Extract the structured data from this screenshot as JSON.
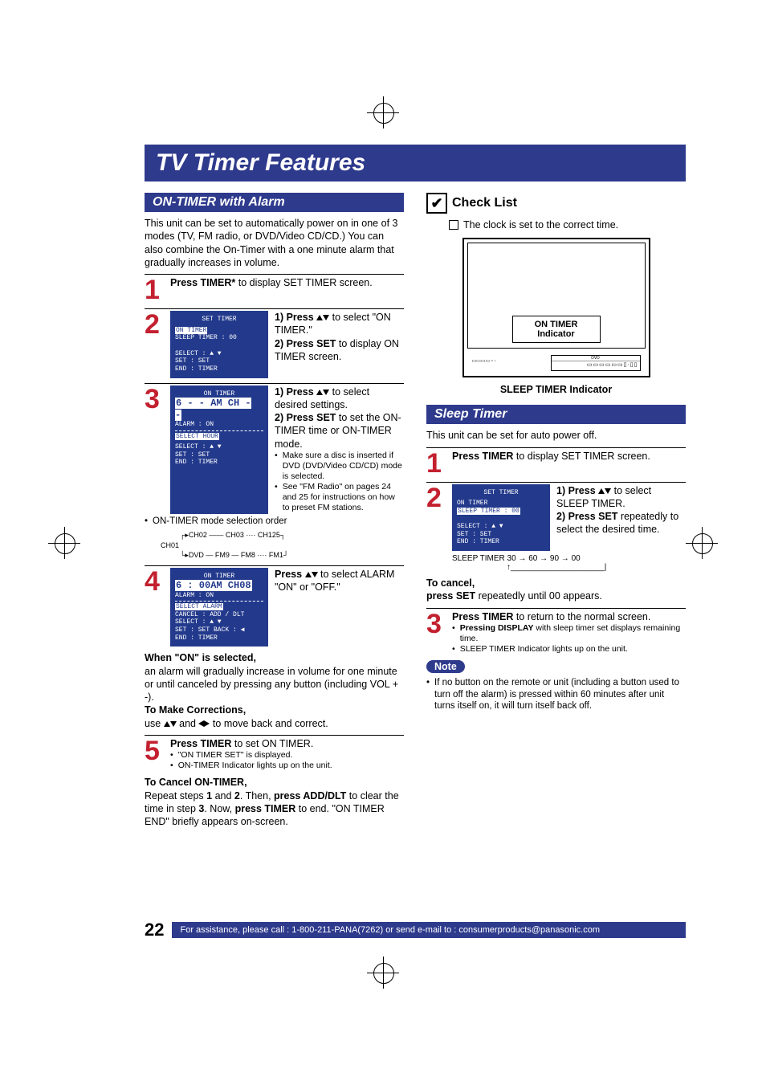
{
  "title": "TV Timer Features",
  "sections": {
    "on_timer_alarm": {
      "header": "ON-TIMER with Alarm",
      "intro": "This unit can be set to automatically power on in one of 3 modes (TV, FM radio, or DVD/Video CD/CD.) You can also combine the On-Timer with a one minute alarm that gradually increases in volume.",
      "step1": {
        "pre": "Press TIMER*",
        "post": " to display SET TIMER screen."
      },
      "step2": {
        "screen": {
          "title": "SET   TIMER",
          "line1_hl": "ON   TIMER",
          "line2": "SLEEP   TIMER : 00",
          "select": "SELECT : ▲  ▼",
          "set": "SET        : SET",
          "end": "END       : TIMER"
        },
        "r1a": "1)  Press ",
        "r1b": " to select \"ON TIMER.\"",
        "r2a": "2)  Press SET",
        "r2b": " to display ON TIMER screen."
      },
      "step3": {
        "screen": {
          "title": "ON   TIMER",
          "time_hl": "6 - - AM  CH - -",
          "alarm": "ALARM : ON",
          "select_line_hl": "SELECT  HOUR",
          "select": "SELECT : ▲  ▼",
          "set": "SET        : SET",
          "end": "END       : TIMER"
        },
        "r1a": "1)  Press ",
        "r1b": " to select desired settings.",
        "r2a": "2)  Press SET",
        "r2b": " to set the ON-TIMER time or ON-TIMER mode.",
        "b1": "Make sure a disc is inserted if DVD (DVD/Video CD/CD) mode is selected.",
        "b2": "See \"FM Radio\" on pages 24 and 25 for instructions on how to preset FM stations.",
        "mode_label": "ON-TIMER mode selection order",
        "chain1": "CH02 —— CH03 ···· CH125",
        "chain_left": "CH01",
        "chain2": "DVD — FM9 — FM8 ···· FM1"
      },
      "step4": {
        "screen": {
          "title": "ON   TIMER",
          "time_hl": "6 : 00AM  CH08",
          "alarm": "ALARM : ON",
          "select_line_hl": "SELECT  ALARM",
          "cancel": "CANCEL : ADD / DLT",
          "select": "SELECT : ▲  ▼",
          "set": "SET        : SET             BACK : ◀",
          "end": "END       : TIMER"
        },
        "r1a": "Press ",
        "r1b": " to select ALARM \"ON\" or \"OFF.\""
      },
      "when_on_header": "When \"ON\" is selected,",
      "when_on_body": "an alarm will gradually increase in volume for one minute or until canceled by pressing any button (including VOL + -).",
      "corrections_header": "To Make Corrections,",
      "corrections_pre": "use ",
      "corrections_mid": " and ",
      "corrections_post": " to move back and correct.",
      "step5": {
        "a": "Press TIMER",
        "b": " to set ON TIMER.",
        "bul1": "\"ON TIMER SET\" is displayed.",
        "bul2": "ON-TIMER Indicator lights up on the unit."
      },
      "cancel_header": "To Cancel ON-TIMER,",
      "cancel_body_1": "Repeat steps ",
      "cancel_body_2": " and ",
      "cancel_body_3": ". Then, ",
      "cancel_body_4": "press ADD/DLT",
      "cancel_body_5": " to clear the time in step ",
      "cancel_body_6": ". Now, ",
      "cancel_body_7": "press TIMER",
      "cancel_body_8": " to end. \"ON TIMER END\" briefly appears on-screen.",
      "cancel_s1": "1",
      "cancel_s2": "2",
      "cancel_s3": "3"
    },
    "checklist": {
      "header": "Check List",
      "item1": "The clock is set to the correct time.",
      "on_indicator": "ON TIMER Indicator",
      "sleep_indicator": "SLEEP TIMER Indicator"
    },
    "sleep_timer": {
      "header": "Sleep Timer",
      "intro": "This unit can be set for auto power off.",
      "step1a": "Press TIMER",
      "step1b": " to display SET TIMER screen.",
      "step2": {
        "screen": {
          "title": "SET   TIMER",
          "line1": "ON   TIMER",
          "line2_hl": "SLEEP   TIMER : 00",
          "select": "SELECT : ▲  ▼",
          "set": "SET        : SET",
          "end": "END       : TIMER"
        },
        "r1a": "1)  Press ",
        "r1b": " to select SLEEP TIMER.",
        "r2a": "2)  Press SET",
        "r2b": " repeatedly to select the desired time.",
        "chain": "SLEEP TIMER   30 → 60 → 90 → 00"
      },
      "cancel_header": "To cancel,",
      "cancel_body_a": "press SET",
      "cancel_body_b": " repeatedly until 00 appears.",
      "step3a": "Press TIMER",
      "step3b": " to return to the normal screen.",
      "step3_bul1a": "Pressing DISPLAY",
      "step3_bul1b": " with sleep timer set displays remaining time.",
      "step3_bul2": "SLEEP TIMER Indicator lights up on the unit.",
      "note_label": "Note",
      "note_body": "If no button on the remote or unit (including a button used to turn off the alarm) is pressed within 60 minutes after unit turns itself on, it will turn itself back off."
    }
  },
  "footer": {
    "page": "22",
    "text": "For assistance, please call : 1-800-211-PANA(7262) or send e-mail to : consumerproducts@panasonic.com"
  }
}
